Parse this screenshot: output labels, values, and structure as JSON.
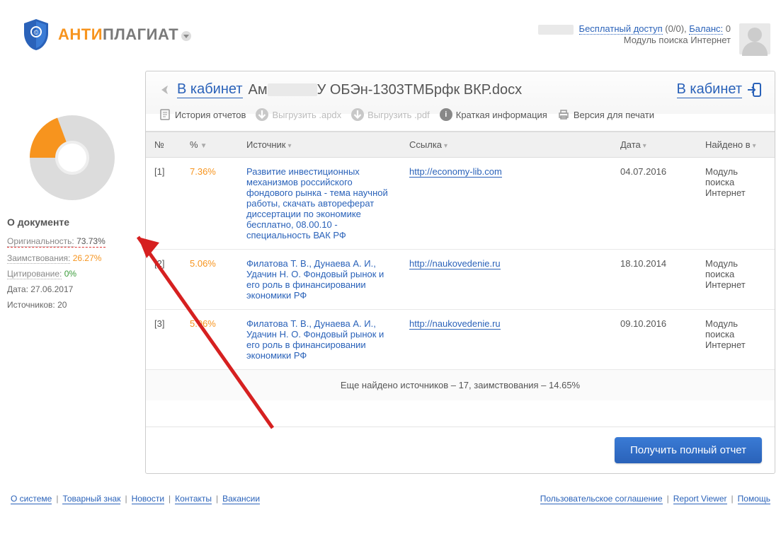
{
  "logo": {
    "anti": "АНТИ",
    "plag": "ПЛАГИАТ"
  },
  "header_right": {
    "free_access": "Бесплатный доступ",
    "free_count": "(0/0),",
    "balance_label": "Баланс:",
    "balance_value": "0",
    "module": "Модуль поиска Интернет"
  },
  "crumb": {
    "back": "В кабинет",
    "title_pre": "Ам",
    "title_post": "У ОБЭн-1303ТМБрфк ВКР.docx",
    "right": "В кабинет"
  },
  "toolbar": {
    "history": "История отчетов",
    "export_apdx": "Выгрузить .apdx",
    "export_pdf": "Выгрузить .pdf",
    "short_info": "Краткая информация",
    "print": "Версия для печати"
  },
  "sidebar": {
    "title": "О документе",
    "originality_label": "Оригинальность:",
    "originality_value": "73.73%",
    "borrow_label": "Заимствования:",
    "borrow_value": "26.27%",
    "cite_label": "Цитирование:",
    "cite_value": "0%",
    "date_label": "Дата:",
    "date_value": "27.06.2017",
    "sources_label": "Источников:",
    "sources_value": "20"
  },
  "columns": {
    "num": "№",
    "pct": "%",
    "source": "Источник",
    "link": "Ссылка",
    "date": "Дата",
    "found_in": "Найдено в"
  },
  "rows": [
    {
      "n": "[1]",
      "pct": "7.36%",
      "src": "Развитие инвестиционных механизмов российского фондового рынка - тема научной работы, скачать автореферат диссертации по экономике бесплатно, 08.00.10 - специальность ВАК РФ",
      "link": "http://economy-lib.com",
      "date": "04.07.2016",
      "found": "Модуль поиска Интернет"
    },
    {
      "n": "[2]",
      "pct": "5.06%",
      "src": "Филатова Т. В., Дунаева А. И., Удачин Н. О. Фондовый рынок и его роль в финансировании экономики РФ",
      "link": "http://naukovedenie.ru",
      "date": "18.10.2014",
      "found": "Модуль поиска Интернет"
    },
    {
      "n": "[3]",
      "pct": "5.06%",
      "src": "Филатова Т. В., Дунаева А. И., Удачин Н. О. Фондовый рынок и его роль в финансировании экономики РФ",
      "link": "http://naukovedenie.ru",
      "date": "09.10.2016",
      "found": "Модуль поиска Интернет"
    }
  ],
  "more_sources": "Еще найдено источников – 17, заимствования – 14.65%",
  "button_full": "Получить полный отчет",
  "footer_left": [
    "О системе",
    "Товарный знак",
    "Новости",
    "Контакты",
    "Вакансии"
  ],
  "footer_right": [
    "Пользовательское соглашение",
    "Report Viewer",
    "Помощь"
  ],
  "chart_data": {
    "type": "pie",
    "title": "О документе",
    "series": [
      {
        "name": "Оригинальность",
        "value": 73.73,
        "color": "#dcdcdc"
      },
      {
        "name": "Заимствования",
        "value": 26.27,
        "color": "#f7941e"
      },
      {
        "name": "Цитирование",
        "value": 0,
        "color": "#3a9b3a"
      }
    ]
  }
}
